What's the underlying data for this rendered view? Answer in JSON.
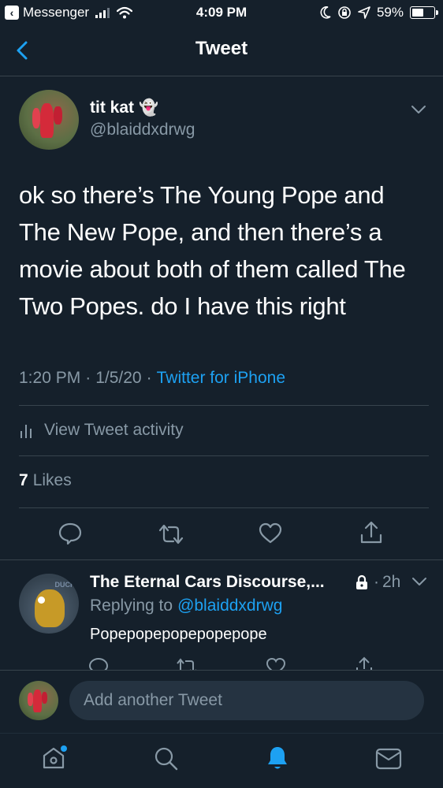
{
  "status_bar": {
    "back_app": "Messenger",
    "time": "4:09 PM",
    "battery_percent": "59%",
    "battery_level": 0.59
  },
  "header": {
    "title": "Tweet"
  },
  "tweet": {
    "author_name": "tit kat",
    "author_emoji": "👻",
    "handle": "@blaiddxdrwg",
    "text": "ok so there’s The Young Pope and The New Pope, and then there’s a movie about both of them called The Two Popes. do I have this right",
    "time": "1:20 PM",
    "sep1": "·",
    "date": "1/5/20",
    "sep2": "·",
    "source": "Twitter for iPhone",
    "activity_label": "View Tweet activity",
    "likes_count": "7",
    "likes_label": "Likes"
  },
  "reply": {
    "author_name": "The Eternal Cars Discourse,...",
    "sep": "·",
    "age": "2h",
    "replying_prefix": "Replying to",
    "replying_handle": "@blaiddxdrwg",
    "text": "Popepopepopepopepope",
    "avatar_tag": "DUCK"
  },
  "composer": {
    "placeholder": "Add another Tweet"
  },
  "colors": {
    "background": "#15202b",
    "accent": "#1da1f2",
    "muted": "#8899a6",
    "divider": "#38444d"
  },
  "icons": [
    "back-chevron-icon",
    "signal-icon",
    "wifi-icon",
    "moon-icon",
    "rotation-lock-icon",
    "location-icon",
    "battery-icon",
    "chevron-down-icon",
    "activity-bars-icon",
    "reply-icon",
    "retweet-icon",
    "like-icon",
    "share-icon",
    "lock-icon",
    "home-icon",
    "search-icon",
    "notifications-icon",
    "messages-icon"
  ]
}
